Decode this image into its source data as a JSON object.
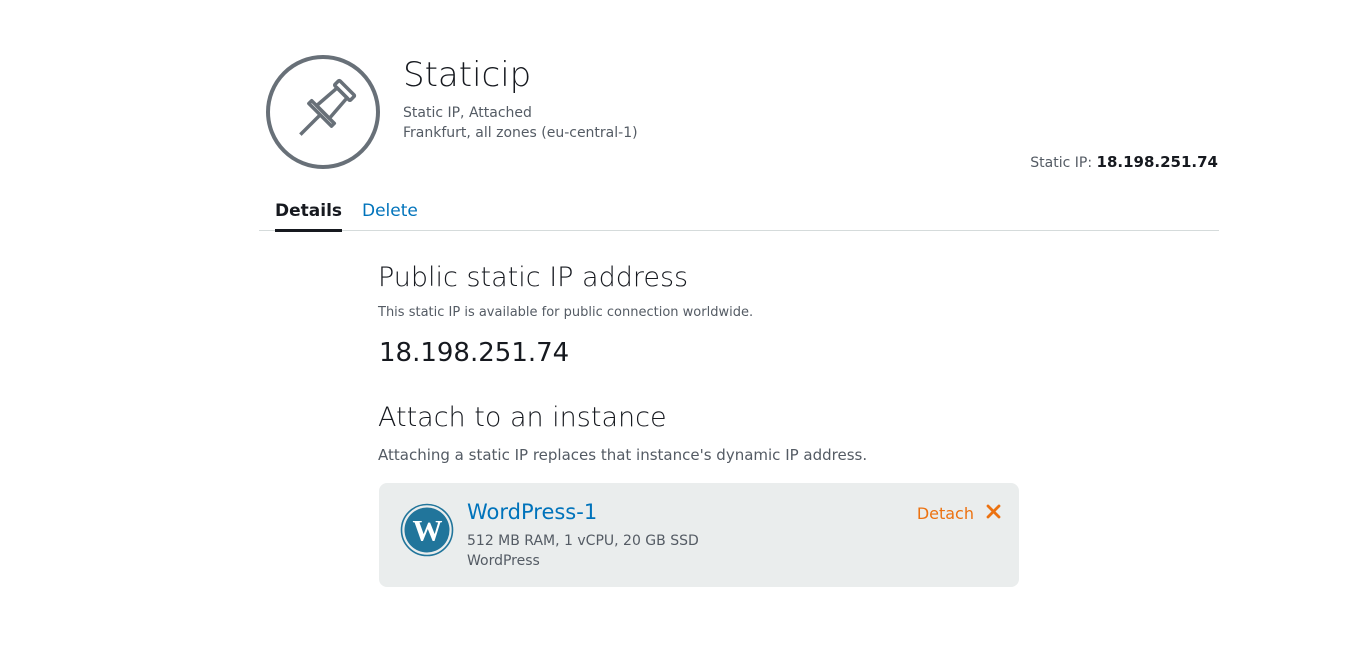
{
  "header": {
    "title": "Staticip",
    "type_status": "Static IP, Attached",
    "location": "Frankfurt, all zones (eu-central-1)",
    "static_ip_label": "Static IP:",
    "static_ip_value": "18.198.251.74",
    "icon": "pushpin-icon"
  },
  "tabs": [
    {
      "label": "Details",
      "active": true
    },
    {
      "label": "Delete",
      "active": false
    }
  ],
  "public_ip_section": {
    "heading": "Public static IP address",
    "description": "This static IP is available for public connection worldwide.",
    "ip": "18.198.251.74"
  },
  "attach_section": {
    "heading": "Attach to an instance",
    "description": "Attaching a static IP replaces that instance's dynamic IP address.",
    "instance": {
      "name": "WordPress-1",
      "specs": "512 MB RAM, 1 vCPU, 20 GB SSD",
      "blueprint": "WordPress",
      "icon": "wordpress-icon",
      "detach_label": "Detach",
      "detach_icon": "close-icon"
    }
  },
  "colors": {
    "link": "#0073bb",
    "action": "#ec7211",
    "card_bg": "#eaeded",
    "icon_gray": "#687078",
    "wordpress_blue": "#21759b"
  }
}
